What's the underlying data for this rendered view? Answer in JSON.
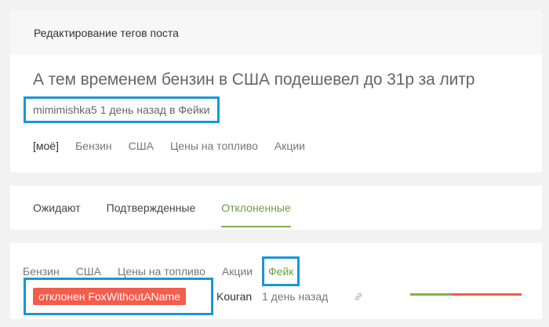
{
  "header": {
    "title": "Редактирование тегов поста"
  },
  "post": {
    "title": "А тем временем бензин в США подешевел до 31р за литр",
    "author": "mimimishka5",
    "time": "1 день назад",
    "in_word": "в",
    "community": "Фейки",
    "tags": [
      "[моё]",
      "Бензин",
      "США",
      "Цены на топливо",
      "Акции"
    ]
  },
  "tabs": [
    {
      "label": "Ожидают",
      "active": false
    },
    {
      "label": "Подтвержденные",
      "active": false
    },
    {
      "label": "Отклоненные",
      "active": true
    }
  ],
  "rejected": {
    "tags": [
      "Бензин",
      "США",
      "Цены на топливо",
      "Акции"
    ],
    "highlight_tag": "Фейк",
    "status_badge": "отклонен FoxWithoutAName",
    "user": "Kouran",
    "time": "1 день назад",
    "link_icon": "link-icon",
    "vote_positive_fraction": 0.37
  },
  "colors": {
    "accent_green": "#6b9e3b",
    "reject_red": "#f45c4c",
    "highlight_blue": "#1a96d6"
  }
}
